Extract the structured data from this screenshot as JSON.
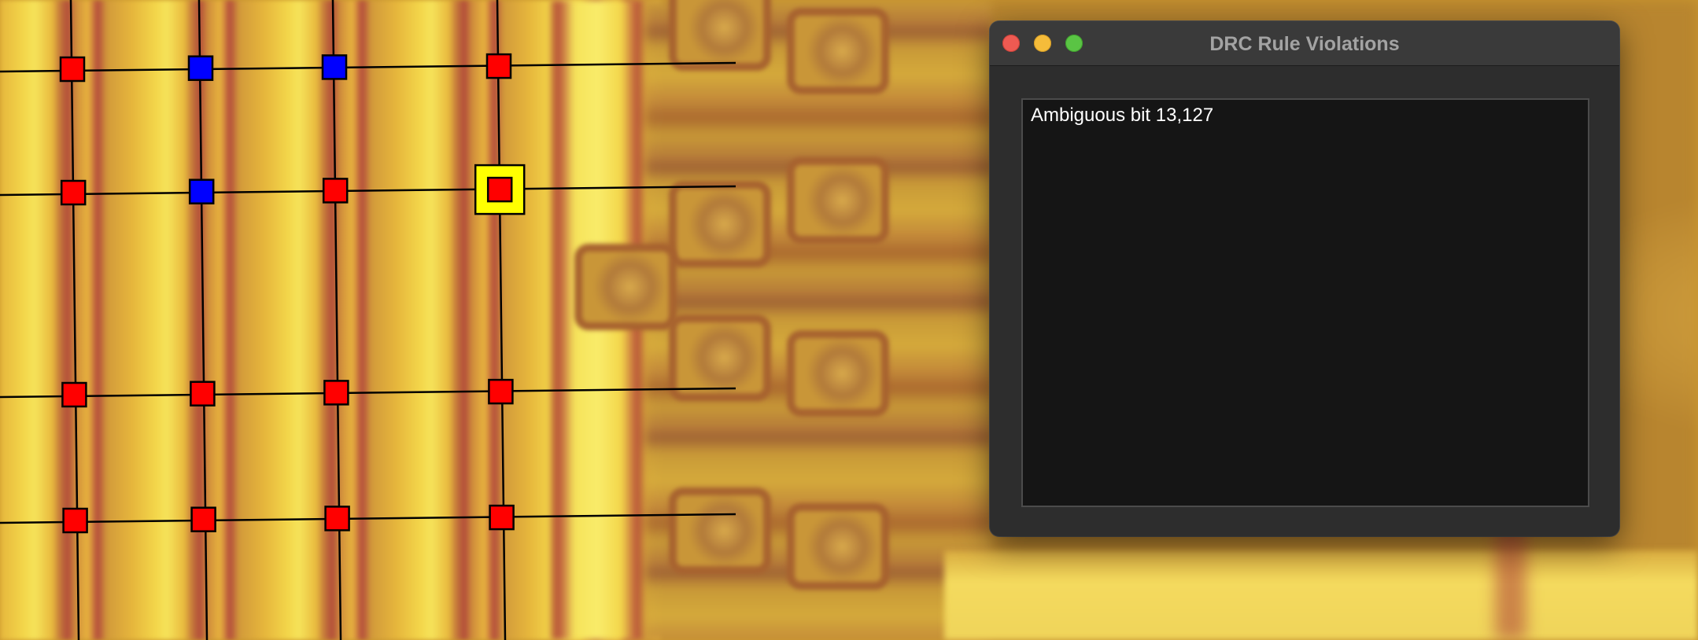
{
  "window": {
    "title": "DRC Rule Violations",
    "buttons": [
      "close",
      "minimize",
      "zoom"
    ]
  },
  "violations": [
    {
      "label": "Ambiguous bit 13,127"
    }
  ],
  "overlay": {
    "colors": {
      "one": "#ff0000",
      "zero": "#0000ff",
      "selected": "#ffff00",
      "line": "#000000"
    },
    "bit_rows": [
      [
        "one",
        "zero",
        "zero",
        "one"
      ],
      [
        "one",
        "zero",
        "one",
        "one"
      ],
      [
        "one",
        "one",
        "one",
        "one"
      ],
      [
        "one",
        "one",
        "one",
        "one"
      ]
    ],
    "selected": {
      "row": 1,
      "col": 3
    }
  }
}
